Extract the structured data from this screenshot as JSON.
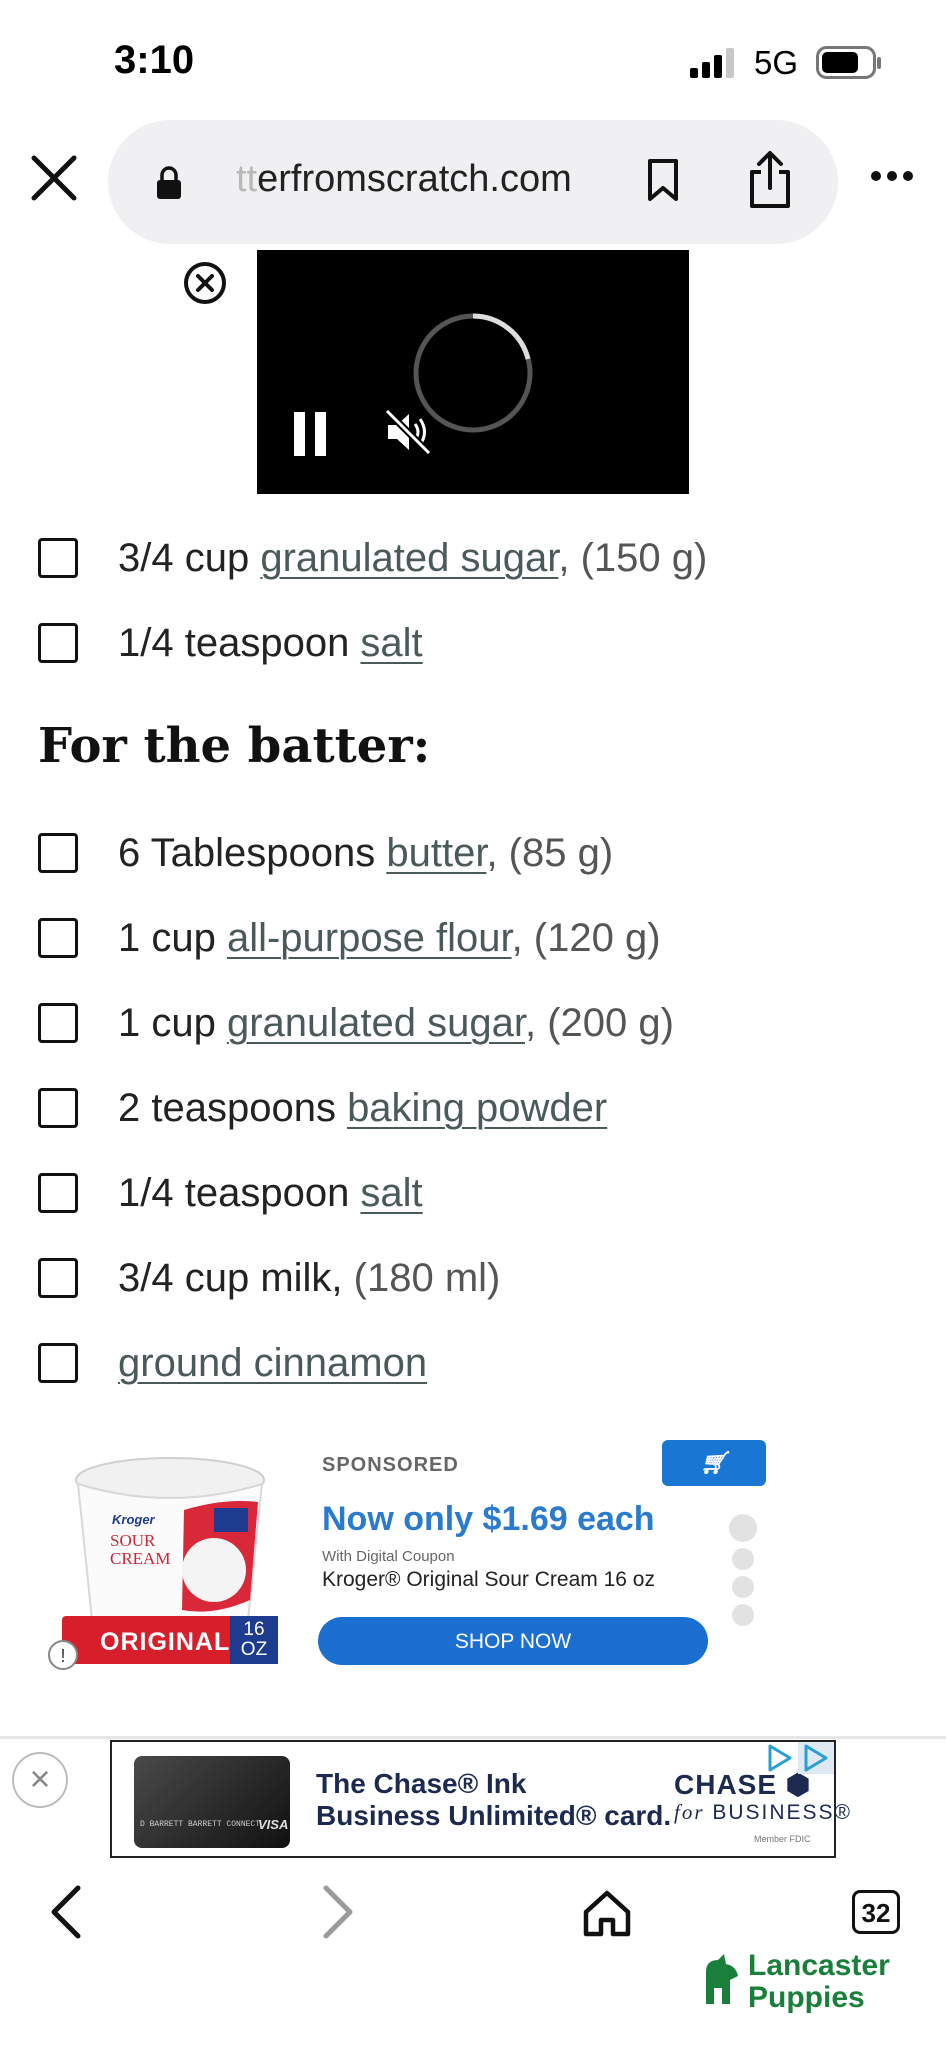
{
  "status_bar": {
    "time": "3:10",
    "network": "5G"
  },
  "browser": {
    "url_faded": "tt",
    "url_main": "erfromscratch.com"
  },
  "ingredients_top": [
    {
      "amount": "3/4 cup ",
      "ingredient": "granulated sugar",
      "note": ", (150 g)"
    },
    {
      "amount": "1/4 teaspoon ",
      "ingredient": "salt",
      "note": ""
    }
  ],
  "section_heading": "For the batter:",
  "ingredients_batter": [
    {
      "amount": "6 Tablespoons ",
      "ingredient": "butter",
      "note": ", (85 g)"
    },
    {
      "amount": "1 cup ",
      "ingredient": "all-purpose flour",
      "note": ", (120 g)"
    },
    {
      "amount": "1 cup ",
      "ingredient": "granulated sugar",
      "note": ", (200 g)"
    },
    {
      "amount": "2 teaspoons ",
      "ingredient": "baking powder",
      "note": ""
    },
    {
      "amount": "1/4 teaspoon ",
      "ingredient": "salt",
      "note": ""
    },
    {
      "amount": "3/4 cup milk, ",
      "ingredient": "",
      "note": "(180 ml)"
    },
    {
      "amount": "",
      "ingredient": "ground cinnamon",
      "note": ""
    }
  ],
  "sponsored_ad": {
    "label": "SPONSORED",
    "brand": "Kroger",
    "price_text": "Now only $1.69 each",
    "coupon_text": "With Digital Coupon",
    "product": "Kroger® Original Sour Cream 16 oz",
    "button": "SHOP NOW",
    "band_label": "ORIGINAL",
    "size_num": "16",
    "size_unit": "OZ",
    "tub_lines": [
      "Kroger",
      "SOUR",
      "CREAM"
    ]
  },
  "banner_ad": {
    "line1": "The Chase® Ink",
    "line2": "Business Unlimited® card.",
    "logo": "CHASE",
    "biz_for": "for",
    "biz": "BUSINESS®",
    "fdic": "Member FDIC",
    "card_network": "VISA",
    "card_holder": "D BARRETT BARRETT CONNECT"
  },
  "bottom_nav": {
    "tab_count": "32"
  },
  "watermark": {
    "line1": "Lancaster",
    "line2": "Puppies"
  },
  "colors": {
    "link": "#4a5a5a",
    "price": "#2a7bd0",
    "shop_button": "#1a6fd1",
    "kroger": "#1976d2",
    "chase_navy": "#1b2a4e"
  }
}
